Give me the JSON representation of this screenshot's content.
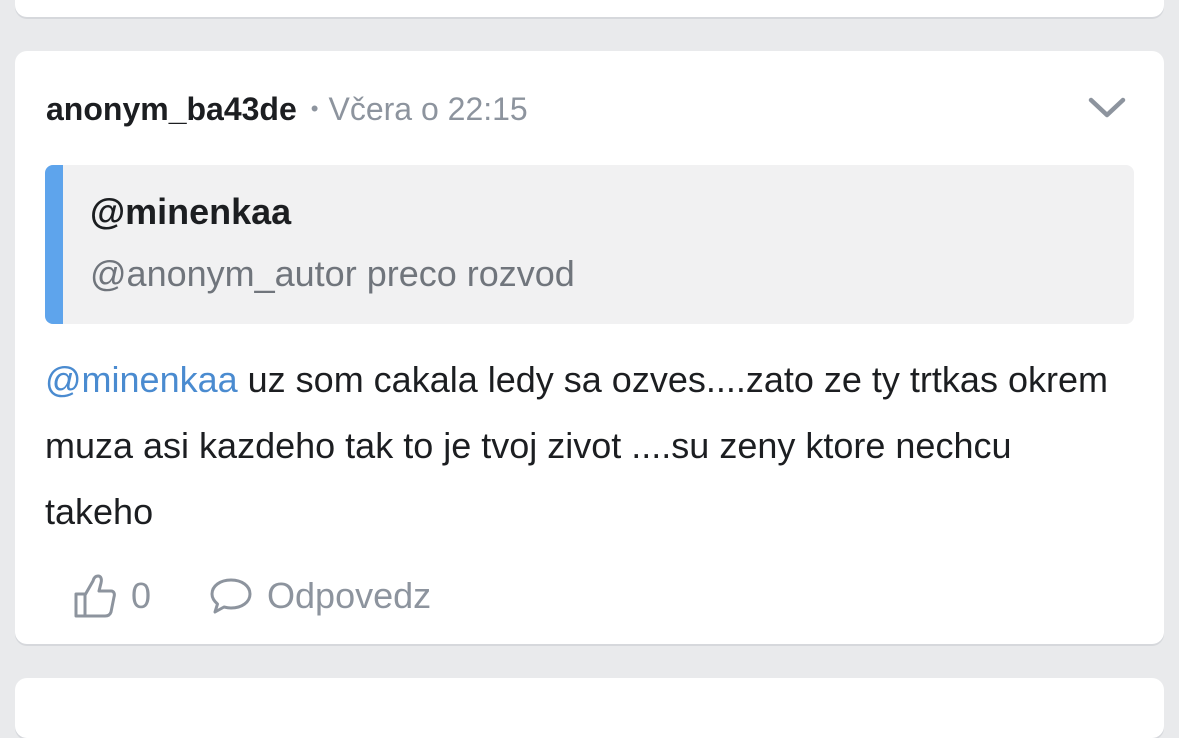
{
  "comment": {
    "username": "anonym_ba43de",
    "separator": "•",
    "timestamp": "Včera o 22:15",
    "quote": {
      "author": "@minenkaa",
      "text": "@anonym_autor preco rozvod"
    },
    "mention": "@minenkaa",
    "text": " uz som cakala ledy sa ozves....zato ze ty trtkas okrem muza asi kazdeho tak to je tvoj zivot ....su zeny ktore nechcu takeho",
    "likes": "0",
    "reply_label": "Odpovedz"
  },
  "colors": {
    "background": "#e9eaec",
    "card": "#ffffff",
    "quote_bar": "#5ea4ec",
    "mention": "#4a8bd0",
    "muted": "#8d949e"
  },
  "icons": {
    "menu": "chevron-down-icon",
    "like": "thumbs-up-icon",
    "reply": "speech-bubble-icon"
  }
}
